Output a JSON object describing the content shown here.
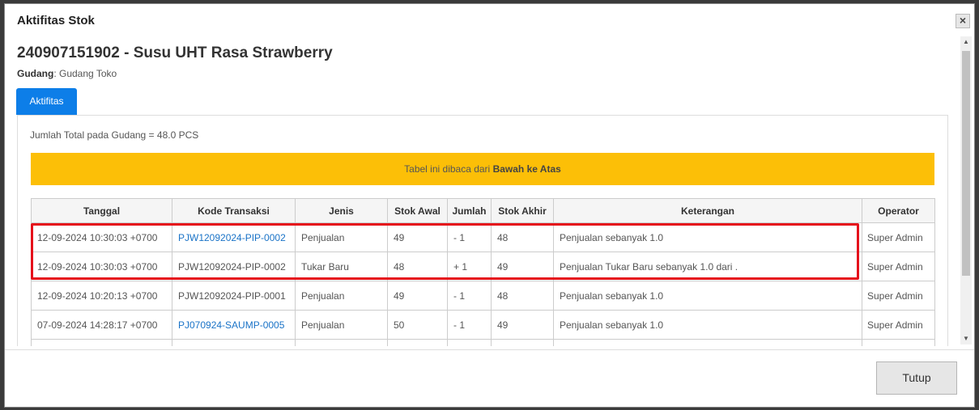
{
  "modal": {
    "title": "Aktifitas Stok",
    "close_label": "×",
    "product_title": "240907151902 - Susu UHT Rasa Strawberry",
    "gudang_label": "Gudang",
    "gudang_value": ": Gudang Toko",
    "tab_label": "Aktifitas",
    "total_text": "Jumlah Total pada Gudang = 48.0 PCS",
    "banner_prefix": "Tabel ini dibaca dari ",
    "banner_bold": "Bawah ke Atas",
    "footer_button": "Tutup"
  },
  "table": {
    "headers": [
      "Tanggal",
      "Kode Transaksi",
      "Jenis",
      "Stok Awal",
      "Jumlah",
      "Stok Akhir",
      "Keterangan",
      "Operator"
    ],
    "rows": [
      {
        "tanggal": "12-09-2024 10:30:03 +0700",
        "kode": "PJW12092024-PIP-0002",
        "kode_link": true,
        "jenis": "Penjualan",
        "stok_awal": "49",
        "jumlah": "- 1",
        "stok_akhir": "48",
        "keterangan": "Penjualan sebanyak 1.0",
        "operator": "Super Admin"
      },
      {
        "tanggal": "12-09-2024 10:30:03 +0700",
        "kode": "PJW12092024-PIP-0002",
        "kode_link": false,
        "jenis": "Tukar Baru",
        "stok_awal": "48",
        "jumlah": "+ 1",
        "stok_akhir": "49",
        "keterangan": "Penjualan Tukar Baru sebanyak 1.0 dari .",
        "operator": "Super Admin"
      },
      {
        "tanggal": "12-09-2024 10:20:13 +0700",
        "kode": "PJW12092024-PIP-0001",
        "kode_link": false,
        "jenis": "Penjualan",
        "stok_awal": "49",
        "jumlah": "- 1",
        "stok_akhir": "48",
        "keterangan": "Penjualan sebanyak 1.0",
        "operator": "Super Admin"
      },
      {
        "tanggal": "07-09-2024 14:28:17 +0700",
        "kode": "PJ070924-SAUMP-0005",
        "kode_link": true,
        "jenis": "Penjualan",
        "stok_awal": "50",
        "jumlah": "- 1",
        "stok_akhir": "49",
        "keterangan": "Penjualan sebanyak 1.0",
        "operator": "Super Admin"
      }
    ]
  },
  "colors": {
    "tab_bg": "#0d7ee8",
    "banner_bg": "#fcbf07",
    "highlight_border": "#e5111b",
    "link": "#1a73c7"
  },
  "icons": {
    "close": "close-icon",
    "scroll_up": "chevron-up-icon",
    "scroll_down": "chevron-down-icon"
  }
}
